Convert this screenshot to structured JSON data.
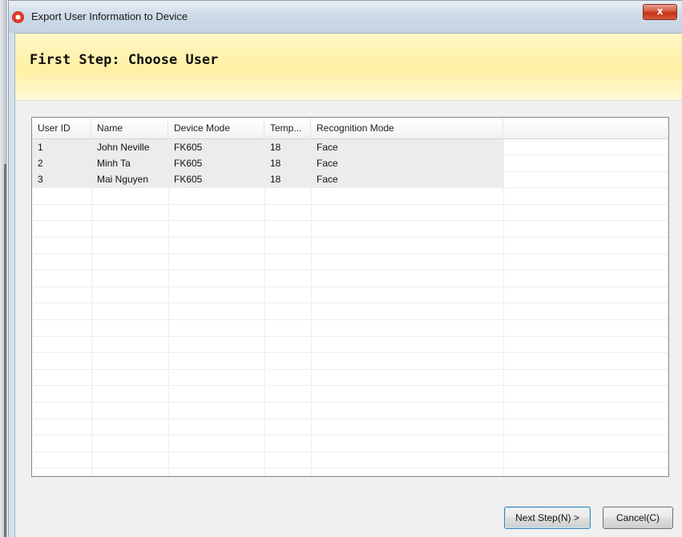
{
  "window": {
    "title": "Export User Information to Device",
    "close_label": "x"
  },
  "header": {
    "title": "First Step: Choose User"
  },
  "table": {
    "columns": [
      "User ID",
      "Name",
      "Device Mode",
      "Temp...",
      "Recognition Mode",
      ""
    ],
    "rows": [
      [
        "1",
        "John Neville",
        "FK605",
        "18",
        "Face"
      ],
      [
        "2",
        "Minh Ta",
        "FK605",
        "18",
        "Face"
      ],
      [
        "3",
        "Mai Nguyen",
        "FK605",
        "18",
        "Face"
      ]
    ]
  },
  "buttons": {
    "next": "Next Step(N) >",
    "cancel": "Cancel(C)"
  }
}
